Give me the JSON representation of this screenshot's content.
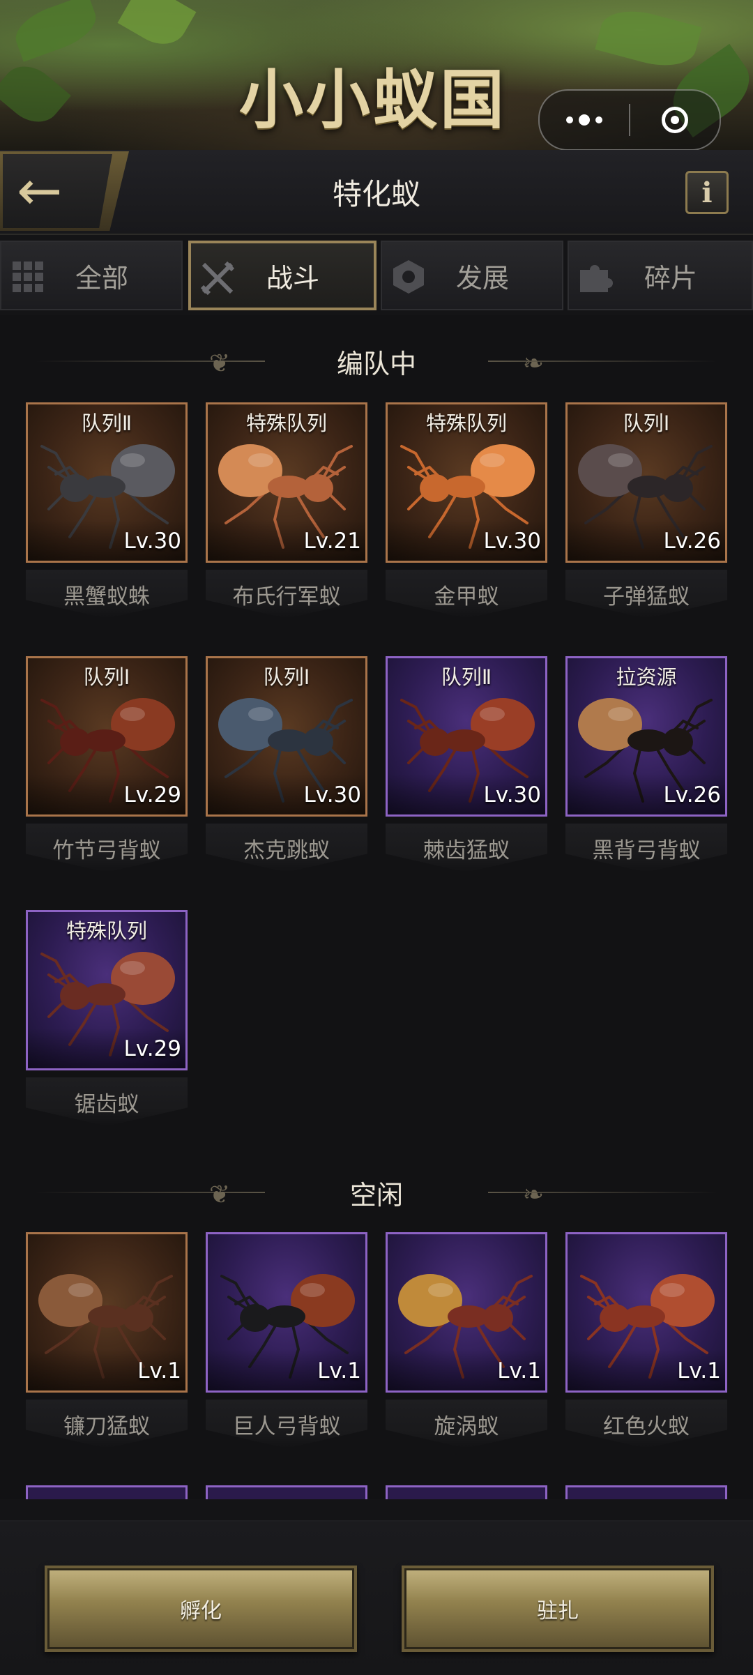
{
  "banner": {
    "game_title": "小小蚁国"
  },
  "header": {
    "title": "特化蚁",
    "back_icon": "arrow-left-icon",
    "info_label": "i"
  },
  "tabs": [
    {
      "label": "全部",
      "icon": "grid-icon",
      "active": false
    },
    {
      "label": "战斗",
      "icon": "crossed-swords-icon",
      "active": true
    },
    {
      "label": "发展",
      "icon": "hexagon-icon",
      "active": false
    },
    {
      "label": "碎片",
      "icon": "puzzle-piece-icon",
      "active": false
    }
  ],
  "sections": {
    "deployed": {
      "title": "编队中",
      "cards": [
        {
          "tag": "队列Ⅱ",
          "level": "Lv.30",
          "name": "黑蟹蚁蛛",
          "frame": "bronze"
        },
        {
          "tag": "特殊队列",
          "level": "Lv.21",
          "name": "布氏行军蚁",
          "frame": "bronze"
        },
        {
          "tag": "特殊队列",
          "level": "Lv.30",
          "name": "金甲蚁",
          "frame": "bronze"
        },
        {
          "tag": "队列Ⅰ",
          "level": "Lv.26",
          "name": "子弹猛蚁",
          "frame": "bronze"
        },
        {
          "tag": "队列Ⅰ",
          "level": "Lv.29",
          "name": "竹节弓背蚁",
          "frame": "bronze"
        },
        {
          "tag": "队列Ⅰ",
          "level": "Lv.30",
          "name": "杰克跳蚁",
          "frame": "bronze"
        },
        {
          "tag": "队列Ⅱ",
          "level": "Lv.30",
          "name": "棘齿猛蚁",
          "frame": "purple"
        },
        {
          "tag": "拉资源",
          "level": "Lv.26",
          "name": "黑背弓背蚁",
          "frame": "purple"
        },
        {
          "tag": "特殊队列",
          "level": "Lv.29",
          "name": "锯齿蚁",
          "frame": "purple"
        }
      ]
    },
    "idle": {
      "title": "空闲",
      "cards": [
        {
          "tag": "",
          "level": "Lv.1",
          "name": "镰刀猛蚁",
          "frame": "bronze"
        },
        {
          "tag": "",
          "level": "Lv.1",
          "name": "巨人弓背蚁",
          "frame": "purple"
        },
        {
          "tag": "",
          "level": "Lv.1",
          "name": "旋涡蚁",
          "frame": "purple"
        },
        {
          "tag": "",
          "level": "Lv.1",
          "name": "红色火蚁",
          "frame": "purple"
        }
      ]
    }
  },
  "actions": {
    "hatch_label": "孵化",
    "station_label": "驻扎"
  },
  "colors": {
    "bronze_frame": "#a9744a",
    "purple_frame": "#8d63c4",
    "gold_button": "#a8965e"
  }
}
